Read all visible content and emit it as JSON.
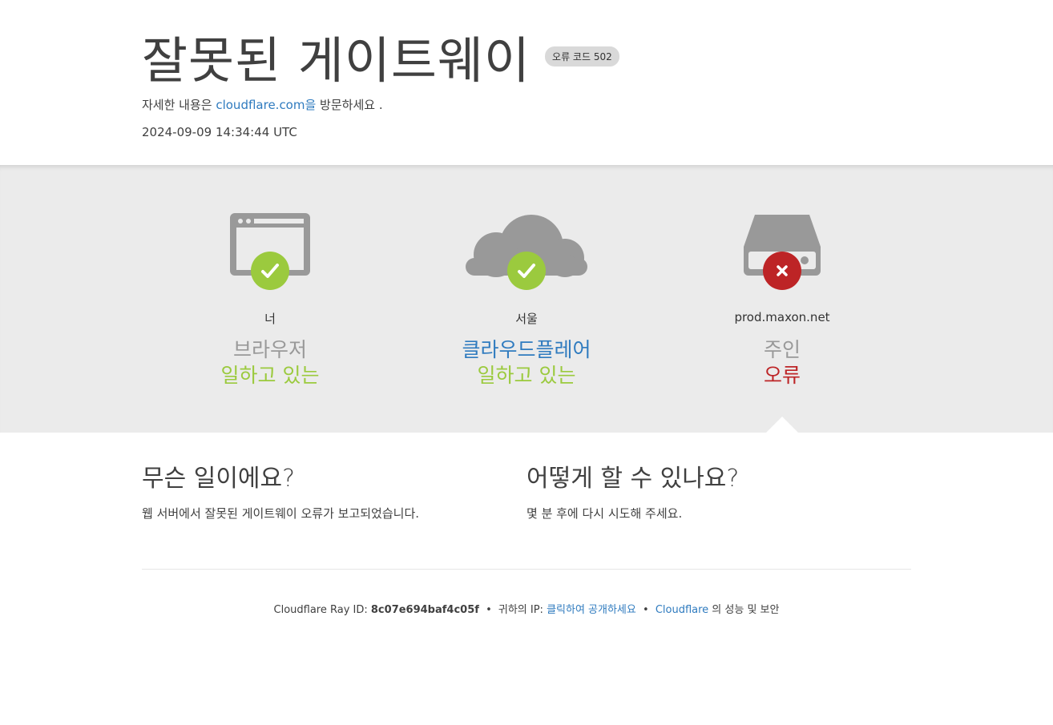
{
  "header": {
    "title": "잘못된 게이트웨이",
    "error_code": "오류 코드 502",
    "more_info_prefix": "자세한 내용은 ",
    "more_info_link": "cloudflare.com을",
    "more_info_suffix": " 방문하세요 .",
    "timestamp": "2024-09-09 14:34:44 UTC"
  },
  "status": [
    {
      "location": "너",
      "name": "브라우저",
      "state": "일하고 있는",
      "ok": true
    },
    {
      "location": "서울",
      "name": "클라우드플레어",
      "state": "일하고 있는",
      "ok": true
    },
    {
      "location": "prod.maxon.net",
      "name": "주인",
      "state": "오류",
      "ok": false
    }
  ],
  "what_happened": {
    "heading": "무슨 일이에요?",
    "text": "웹 서버에서 잘못된 게이트웨이 오류가 보고되었습니다."
  },
  "what_to_do": {
    "heading": "어떻게 할 수 있나요?",
    "text": "몇 분 후에 다시 시도해 주세요."
  },
  "footer": {
    "ray_label": "Cloudflare Ray ID: ",
    "ray_id": "8c07e694baf4c05f",
    "bullet": "•",
    "ip_label": "귀하의 IP: ",
    "ip_link": "클릭하여 공개하세요",
    "cf_link": "Cloudflare",
    "perf_text": " 의 성능 및 보안"
  },
  "colors": {
    "ok": "#9bca3e",
    "error": "#bd2426",
    "link": "#2f7bbf",
    "icon_gray": "#999999"
  }
}
